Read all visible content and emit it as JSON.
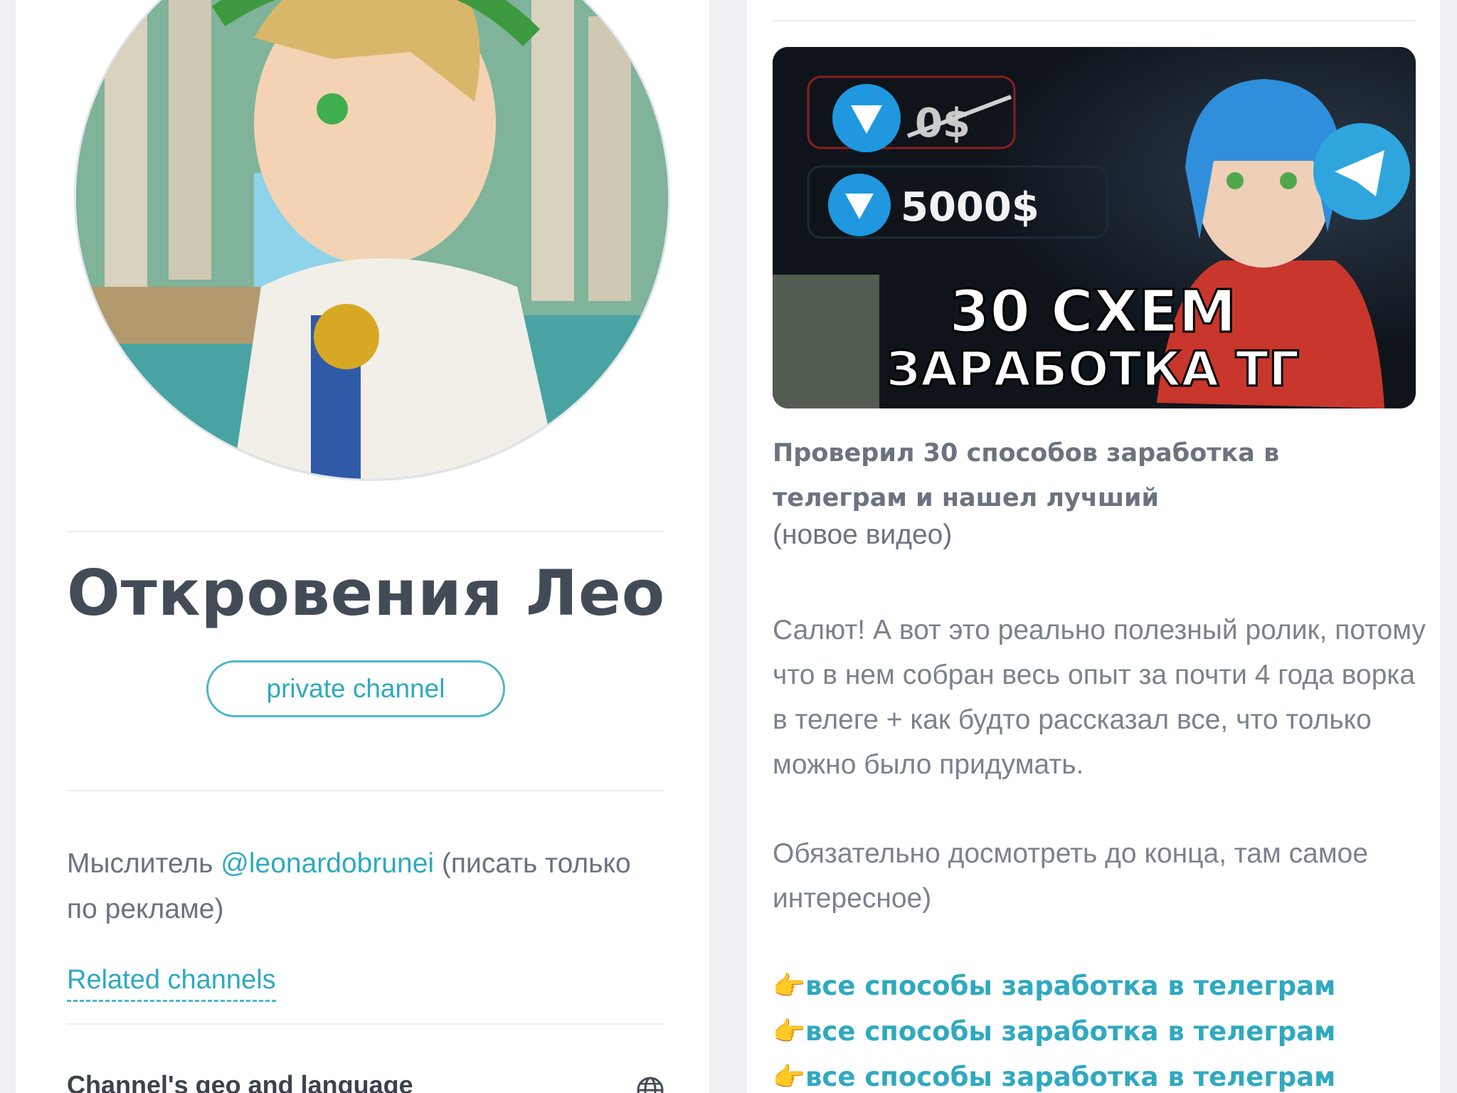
{
  "channel": {
    "title": "Откровения Лео",
    "badge": "private channel",
    "description_prefix": "Мыслитель ",
    "description_mention": "@leonardobrunei",
    "description_suffix": " (писать только по рекламе)",
    "related_label": "Related channels",
    "geo_label": "Channel's geo and language",
    "avatar_icon": "avatar-image"
  },
  "post": {
    "thumbnail": {
      "price_old": "0$",
      "price_new": "5000$",
      "headline_line1": "30 СХЕМ",
      "headline_line2": "ЗАРАБОТКА ТГ"
    },
    "title": "Проверил 30 способов заработка в телеграм и нашел лучший",
    "subtitle": "(новое видео)",
    "paragraph1": "Салют! А вот это реально полезный ролик, потому что в нем собран весь опыт за почти 4 года ворка в телеге + как будто рассказал все, что только можно было придумать.",
    "paragraph2": "Обязательно досмотреть до конца, там самое интересное)",
    "links": [
      {
        "emoji": "👉",
        "label": "все способы заработка в телеграм"
      },
      {
        "emoji": "👉",
        "label": "все способы заработка в телеграм"
      },
      {
        "emoji": "👉",
        "label": "все способы заработка в телеграм"
      }
    ]
  },
  "colors": {
    "accent": "#2fa9c0",
    "text": "#434b57",
    "muted": "#7b828c",
    "background": "#eef0f4"
  }
}
